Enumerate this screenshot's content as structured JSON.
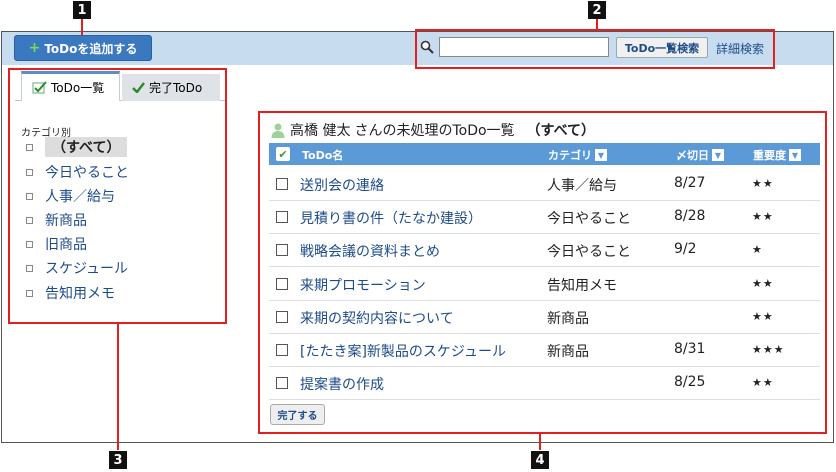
{
  "toolbar": {
    "add_label": "ToDoを追加する",
    "search_placeholder": "",
    "search_button": "ToDo一覧検索",
    "advanced_search": "詳細検索"
  },
  "tabs": [
    {
      "label": "ToDo一覧",
      "icon": "memo-icon",
      "active": true
    },
    {
      "label": "完了ToDo",
      "icon": "checkmark-icon",
      "active": false
    }
  ],
  "sidebar": {
    "title": "カテゴリ別",
    "items": [
      {
        "label": "（すべて）",
        "selected": true
      },
      {
        "label": "今日やること"
      },
      {
        "label": "人事／給与"
      },
      {
        "label": "新商品"
      },
      {
        "label": "旧商品"
      },
      {
        "label": "スケジュール"
      },
      {
        "label": "告知用メモ"
      }
    ]
  },
  "list": {
    "user": "高橋 健太",
    "title_suffix": "さんの未処理のToDo一覧",
    "filter": "（すべて）",
    "columns": {
      "name": "ToDo名",
      "category": "カテゴリ",
      "due": "〆切日",
      "priority": "重要度"
    },
    "rows": [
      {
        "name": "送別会の連絡",
        "category": "人事／給与",
        "due": "8/27",
        "priority": "★★"
      },
      {
        "name": "見積り書の件（たなか建設）",
        "category": "今日やること",
        "due": "8/28",
        "priority": "★★"
      },
      {
        "name": "戦略会議の資料まとめ",
        "category": "今日やること",
        "due": "9/2",
        "priority": "★"
      },
      {
        "name": "来期プロモーション",
        "category": "告知用メモ",
        "due": "",
        "priority": "★★"
      },
      {
        "name": "来期の契約内容について",
        "category": "新商品",
        "due": "",
        "priority": "★★"
      },
      {
        "name": "[たたき案]新製品のスケジュール",
        "category": "新商品",
        "due": "8/31",
        "priority": "★★★"
      },
      {
        "name": "提案書の作成",
        "category": "",
        "due": "8/25",
        "priority": "★★"
      }
    ],
    "done_button": "完了する"
  },
  "callouts": [
    "1",
    "2",
    "3",
    "4"
  ],
  "colors": {
    "accent": "#3a78c0",
    "header": "#5b9ad6",
    "topbar": "#c8dcf0",
    "callout_border": "#e41f1f",
    "link": "#1d4c8a"
  }
}
